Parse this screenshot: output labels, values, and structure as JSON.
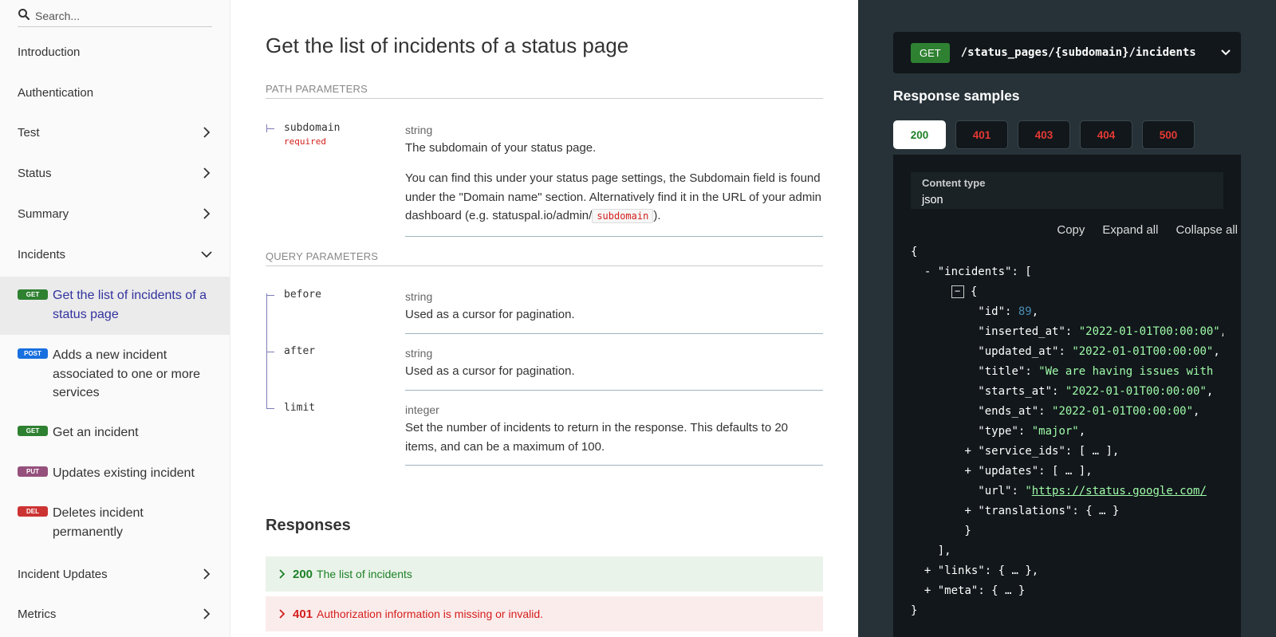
{
  "sidebar": {
    "search_placeholder": "Search...",
    "nav": [
      {
        "label": "Introduction"
      },
      {
        "label": "Authentication"
      },
      {
        "label": "Test"
      },
      {
        "label": "Status"
      },
      {
        "label": "Summary"
      },
      {
        "label": "Incidents"
      }
    ],
    "operations": [
      {
        "method": "GET",
        "label": "Get the list of incidents of a status page",
        "color": "#2f8132"
      },
      {
        "method": "POST",
        "label": "Adds a new incident associated to one or more services",
        "color": "#186fdf"
      },
      {
        "method": "GET",
        "label": "Get an incident",
        "color": "#2f8132"
      },
      {
        "method": "PUT",
        "label": "Updates existing incident",
        "color": "#95507c"
      },
      {
        "method": "DEL",
        "label": "Deletes incident permanently",
        "color": "#cc3333"
      }
    ],
    "nav_bottom": [
      {
        "label": "Incident Updates"
      },
      {
        "label": "Metrics"
      }
    ]
  },
  "main": {
    "title": "Get the list of incidents of a status page",
    "path_params_heading": "PATH PARAMETERS",
    "query_params_heading": "QUERY PARAMETERS",
    "subdomain": {
      "name": "subdomain",
      "required": "required",
      "type": "string",
      "desc": "The subdomain of your status page.",
      "desc2_before": "You can find this under your status page settings, the Subdomain field is found under the \"Domain name\" section. Alternatively find it in the URL of your admin dashboard (e.g. statuspal.io/admin/",
      "desc2_code": "subdomain",
      "desc2_after": ")."
    },
    "before": {
      "name": "before",
      "type": "string",
      "desc": "Used as a cursor for pagination."
    },
    "after": {
      "name": "after",
      "type": "string",
      "desc": "Used as a cursor for pagination."
    },
    "limit": {
      "name": "limit",
      "type": "integer",
      "desc": "Set the number of incidents to return in the response. This defaults to 20 items, and can be a maximum of 100."
    },
    "responses_title": "Responses",
    "responses": [
      {
        "code": "200",
        "desc": "The list of incidents",
        "color": "#1d8127",
        "bg": "#eaf3ea"
      },
      {
        "code": "401",
        "desc": "Authorization information is missing or invalid.",
        "color": "#d41f1c",
        "bg": "#fbecec"
      }
    ]
  },
  "right": {
    "method": "GET",
    "path": "/status_pages/{subdomain}/incidents",
    "samples_title": "Response samples",
    "tabs": [
      "200",
      "401",
      "403",
      "404",
      "500"
    ],
    "content_type_label": "Content type",
    "content_type_value": "json",
    "actions": [
      "Copy",
      "Expand all",
      "Collapse all"
    ],
    "json": {
      "open_brace": "{",
      "incidents_key": "\"incidents\"",
      "id_key": "\"id\"",
      "id_val": "89",
      "inserted_key": "\"inserted_at\"",
      "inserted_val": "\"2022-01-01T00:00:00\"",
      "updated_key": "\"updated_at\"",
      "updated_val": "\"2022-01-01T00:00:00\"",
      "title_key": "\"title\"",
      "title_val": "\"We are having issues with",
      "starts_key": "\"starts_at\"",
      "starts_val": "\"2022-01-01T00:00:00\"",
      "ends_key": "\"ends_at\"",
      "ends_val": "\"2022-01-01T00:00:00\"",
      "type_key": "\"type\"",
      "type_val": "\"major\"",
      "service_ids_key": "\"service_ids\"",
      "collapsed_arr": "[ … ]",
      "updates_key": "\"updates\"",
      "url_key": "\"url\"",
      "url_val": "https://status.google.com/",
      "translations_key": "\"translations\"",
      "collapsed_obj": "{ … }",
      "links_key": "\"links\"",
      "meta_key": "\"meta\"",
      "close_brace": "}"
    }
  }
}
